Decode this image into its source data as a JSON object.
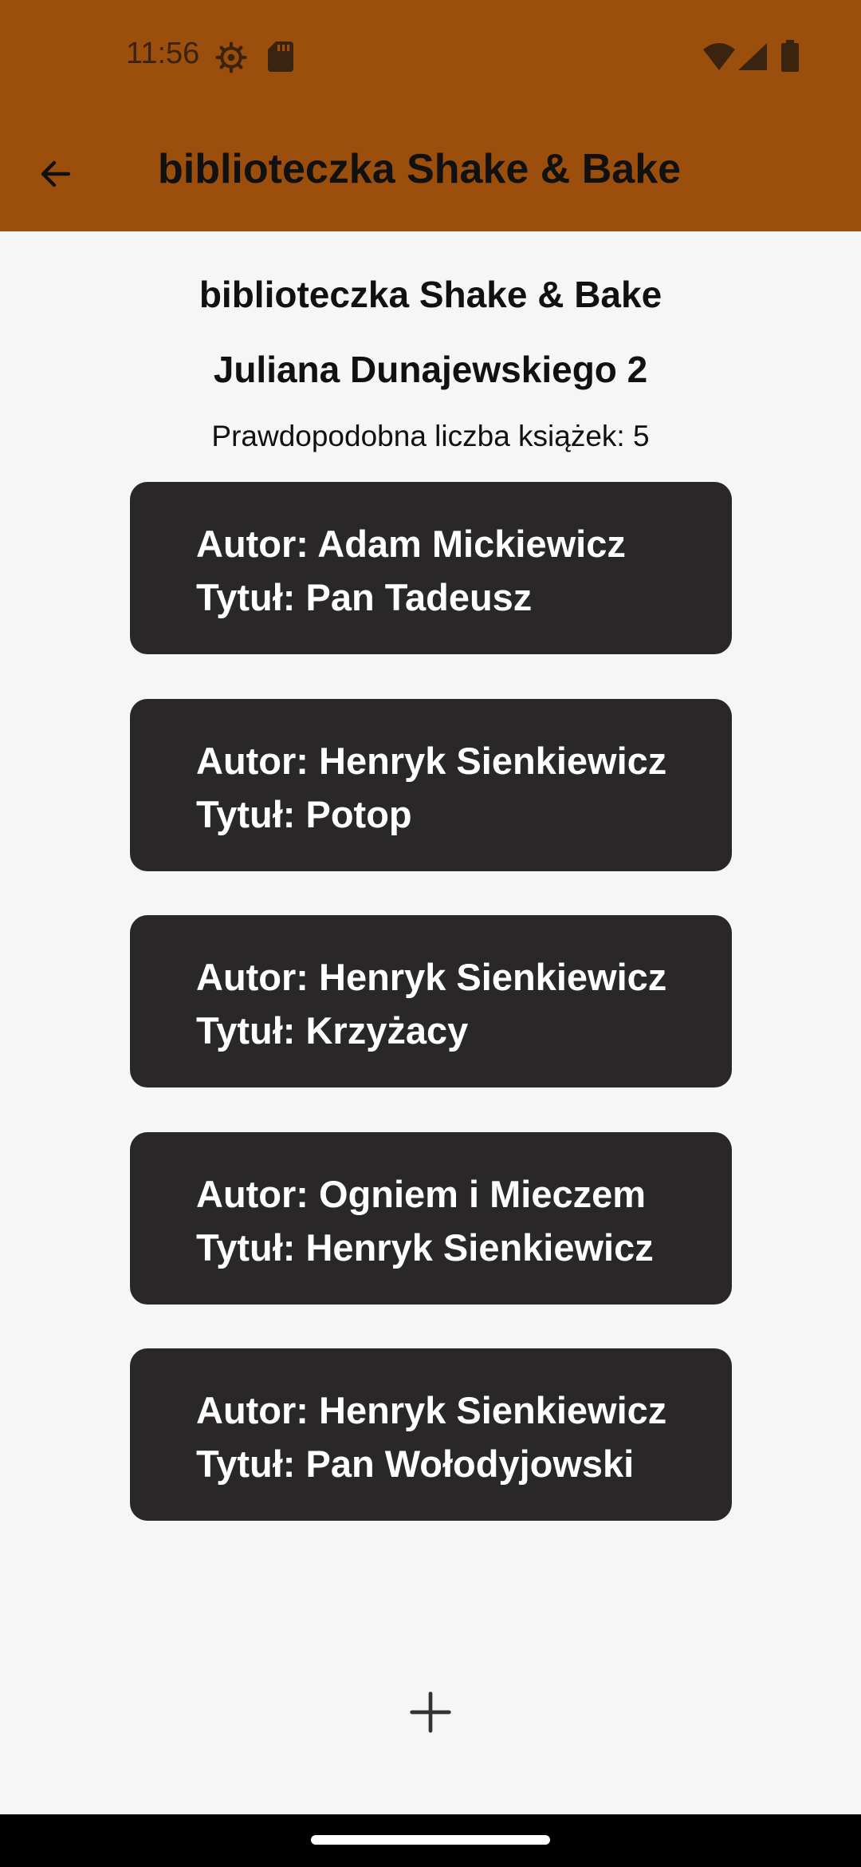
{
  "status_bar": {
    "time": "11:56",
    "icons": [
      "gear-icon",
      "sd-card-icon",
      "wifi-icon",
      "signal-icon",
      "battery-icon"
    ]
  },
  "toolbar": {
    "back_icon": "arrow-left-icon",
    "title": "biblioteczka Shake & Bake"
  },
  "library": {
    "name": "biblioteczka Shake & Bake",
    "address": "Juliana Dunajewskiego 2",
    "book_count_text": "Prawdopodobna liczba książek: 5"
  },
  "books": [
    {
      "author_line": "Autor: Adam Mickiewicz",
      "title_line": "Tytuł: Pan Tadeusz"
    },
    {
      "author_line": "Autor: Henryk Sienkiewicz",
      "title_line": "Tytuł: Potop"
    },
    {
      "author_line": "Autor: Henryk Sienkiewicz",
      "title_line": "Tytuł: Krzyżacy"
    },
    {
      "author_line": "Autor: Ogniem i Mieczem",
      "title_line": "Tytuł: Henryk Sienkiewicz"
    },
    {
      "author_line": "Autor: Henryk Sienkiewicz",
      "title_line": "Tytuł: Pan Wołodyjowski"
    }
  ],
  "add_button": {
    "icon": "plus-icon"
  },
  "colors": {
    "app_bar": "#9c4f0c",
    "background": "#f6f6f7",
    "card": "#2a2729",
    "card_text": "#ffffff"
  }
}
